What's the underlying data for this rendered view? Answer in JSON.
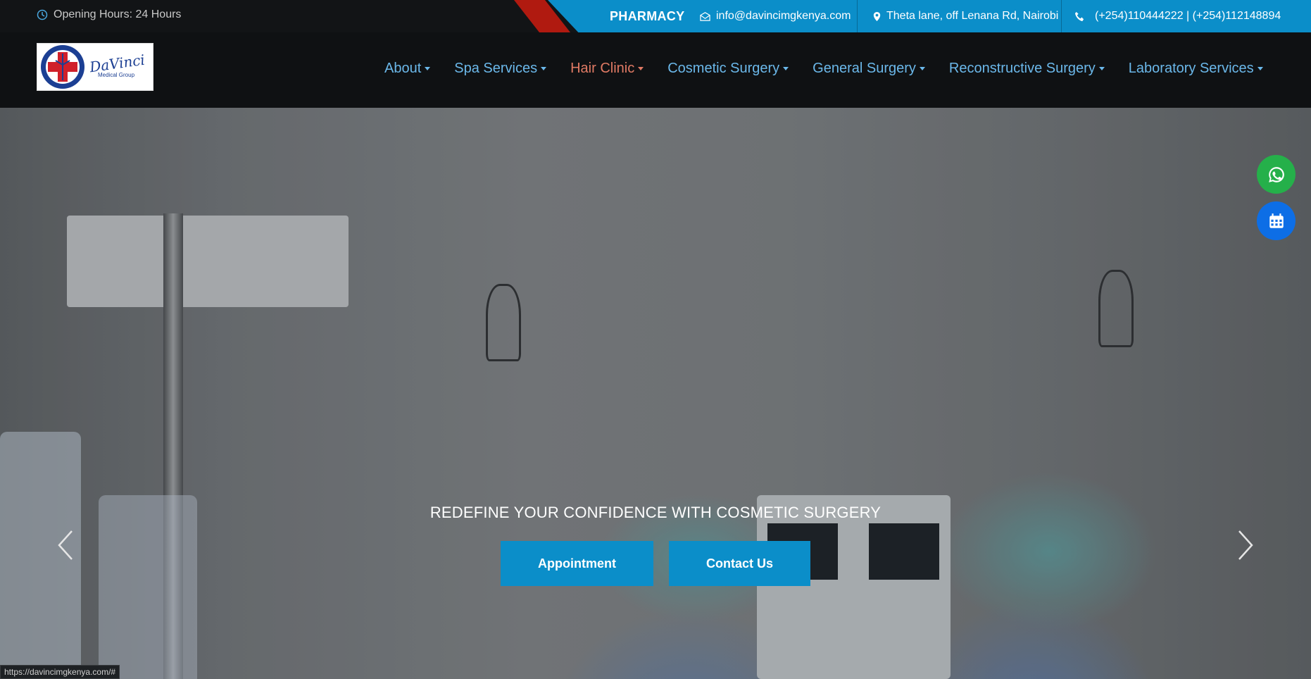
{
  "topbar": {
    "hours": "Opening Hours: 24 Hours",
    "pharmacy": "PHARMACY",
    "email": "info@davincimgkenya.com",
    "address": "Theta lane, off Lenana Rd, Nairobi",
    "phone": "(+254)110444222 | (+254)112148894"
  },
  "logo": {
    "name": "DaVinci",
    "subtitle": "Medical Group"
  },
  "nav": {
    "items": [
      {
        "label": "About"
      },
      {
        "label": "Spa Services"
      },
      {
        "label": "Hair Clinic"
      },
      {
        "label": "Cosmetic Surgery"
      },
      {
        "label": "General Surgery"
      },
      {
        "label": "Reconstructive Surgery"
      },
      {
        "label": "Laboratory Services"
      }
    ],
    "active_index": 2
  },
  "hero": {
    "tagline": "REDEFINE YOUR CONFIDENCE WITH COSMETIC SURGERY",
    "appointment_label": "Appointment",
    "contact_label": "Contact Us"
  },
  "floating": {
    "whatsapp": "whatsapp-icon",
    "calendar": "calendar-icon"
  },
  "status_bar": {
    "url": "https://davincimgkenya.com/#"
  },
  "colors": {
    "accent_blue": "#0b8ec9",
    "accent_red": "#b01a10",
    "nav_link": "#6bb8ea",
    "nav_active": "#e07a64",
    "whatsapp_green": "#25b04a",
    "calendar_blue": "#0d6ee6"
  }
}
